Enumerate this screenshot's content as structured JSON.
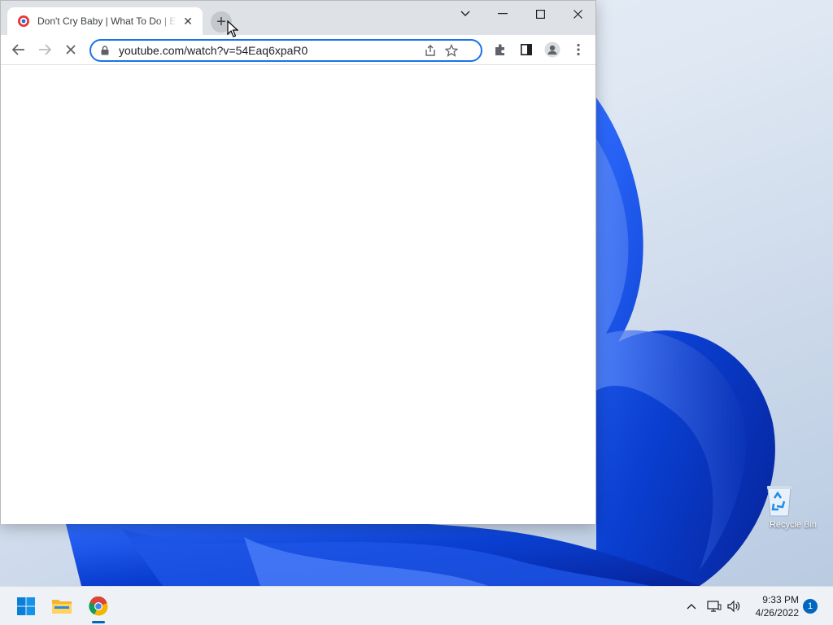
{
  "browser": {
    "tab": {
      "title": "Don't Cry Baby | What To Do | Eli",
      "favicon": "youtube-favicon"
    },
    "new_tab_icon": "plus-icon",
    "window_controls": [
      "tab-search-icon",
      "minimize-icon",
      "maximize-icon",
      "close-icon"
    ],
    "nav": [
      "back-icon",
      "forward-icon",
      "stop-loading-icon"
    ],
    "address": {
      "url": "youtube.com/watch?v=54Eaq6xpaR0",
      "secure_icon": "lock-icon"
    },
    "toolbar_icons": [
      "share-icon",
      "bookmark-star-icon",
      "extensions-icon",
      "side-panel-icon",
      "profile-icon",
      "menu-icon"
    ],
    "accent": "#1a73e8",
    "page_state": "loading"
  },
  "desktop": {
    "icons": [
      {
        "label": "Recycle Bin",
        "icon": "recycle-bin-icon"
      }
    ]
  },
  "taskbar": {
    "apps": [
      {
        "name": "Start",
        "icon": "windows-start-icon"
      },
      {
        "name": "File Explorer",
        "icon": "folder-icon"
      },
      {
        "name": "Google Chrome",
        "icon": "chrome-icon",
        "active": true
      }
    ],
    "tray": {
      "icons": [
        "chevron-up-icon",
        "network-icon",
        "volume-icon"
      ]
    },
    "clock": {
      "time": "9:33 PM",
      "date": "4/26/2022"
    },
    "notifications": "1"
  }
}
